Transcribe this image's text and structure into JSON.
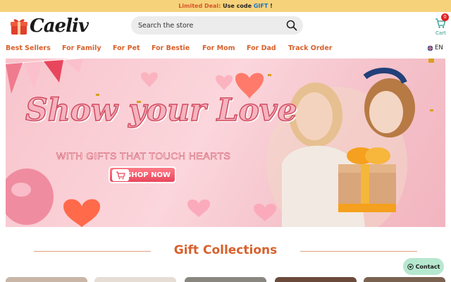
{
  "announcement": {
    "prefix": "Limited Deal:",
    "middle": " Use code ",
    "code": "GIFT",
    "suffix": " !"
  },
  "brand": {
    "name": "Caeliv"
  },
  "search": {
    "placeholder": "Search the store"
  },
  "cart": {
    "label": "Cart",
    "count": "0"
  },
  "nav": {
    "items": [
      "Best Sellers",
      "For Family",
      "For Pet",
      "For Bestie",
      "For Mom",
      "For Dad",
      "Track Order"
    ],
    "language": "EN"
  },
  "hero": {
    "title": "Show your Love",
    "subtitle": "WITH GIFTS THAT TOUCH HEARTS",
    "cta": "SHOP NOW"
  },
  "section": {
    "title": "Gift Collections"
  },
  "contact": {
    "label": "Contact"
  },
  "colors": {
    "accent": "#d8602b",
    "announce_bg": "#f6d27a",
    "hero_pink": "#f8c4cc",
    "contact_bg": "#b6e8cf"
  }
}
